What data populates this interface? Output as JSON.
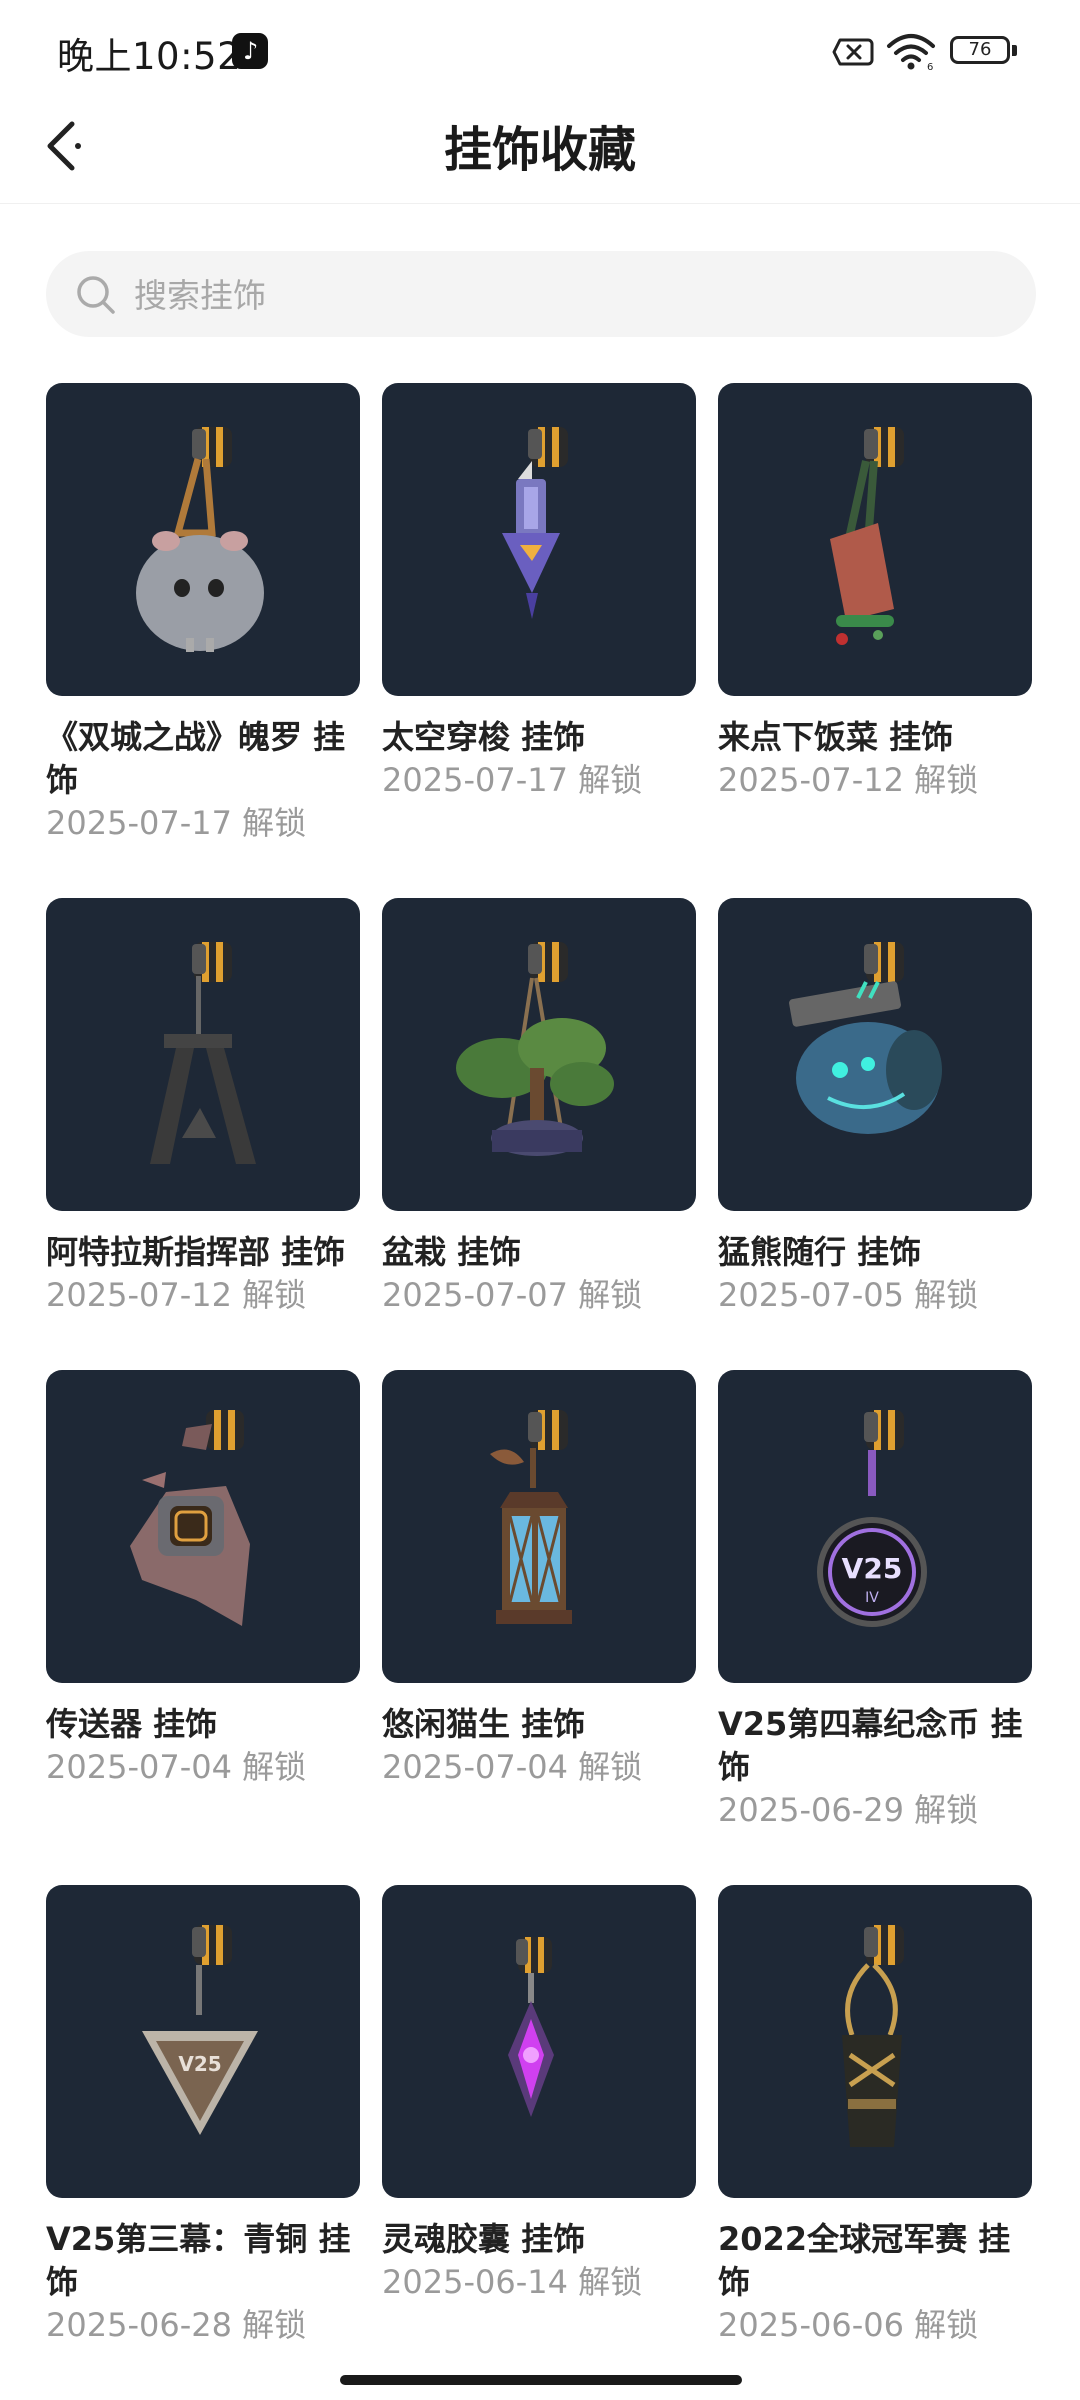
{
  "status_bar": {
    "time": "晚上10:52",
    "battery_level": "76",
    "icons": [
      "tiktok-icon",
      "sim-card-off-icon",
      "wifi-icon",
      "battery-icon"
    ]
  },
  "header": {
    "title": "挂饰收藏",
    "back_icon": "back-arrow-icon"
  },
  "search": {
    "placeholder": "搜索挂饰",
    "value": "",
    "icon": "search-icon"
  },
  "items": [
    {
      "name": "《双城之战》魄罗 挂饰",
      "date": "2025-07-17 解锁",
      "image": "poro-charm"
    },
    {
      "name": "太空穿梭 挂饰",
      "date": "2025-07-17 解锁",
      "image": "space-shuttle-charm"
    },
    {
      "name": "来点下饭菜 挂饰",
      "date": "2025-07-12 解锁",
      "image": "food-charm"
    },
    {
      "name": "阿特拉斯指挥部 挂饰",
      "date": "2025-07-12 解锁",
      "image": "atlas-hq-charm"
    },
    {
      "name": "盆栽 挂饰",
      "date": "2025-07-07 解锁",
      "image": "bonsai-charm"
    },
    {
      "name": "猛熊随行 挂饰",
      "date": "2025-07-05 解锁",
      "image": "bear-charm"
    },
    {
      "name": "传送器 挂饰",
      "date": "2025-07-04 解锁",
      "image": "teleporter-charm"
    },
    {
      "name": "悠闲猫生 挂饰",
      "date": "2025-07-04 解锁",
      "image": "lantern-charm"
    },
    {
      "name": "V25第四幕纪念币 挂饰",
      "date": "2025-06-29 解锁",
      "image": "v25-iv-coin-charm"
    },
    {
      "name": "V25第三幕：青铜 挂饰",
      "date": "2025-06-28 解锁",
      "image": "v25-bronze-charm"
    },
    {
      "name": "灵魂胶囊 挂饰",
      "date": "2025-06-14 解锁",
      "image": "soul-capsule-charm"
    },
    {
      "name": "2022全球冠军赛 挂饰",
      "date": "2025-06-06 解锁",
      "image": "champions-2022-charm"
    }
  ],
  "colors": {
    "thumb_bg": "#1e2836",
    "title_text": "#1a1a1a",
    "date_text": "#9a9a9a",
    "search_bg": "#f4f4f4"
  }
}
